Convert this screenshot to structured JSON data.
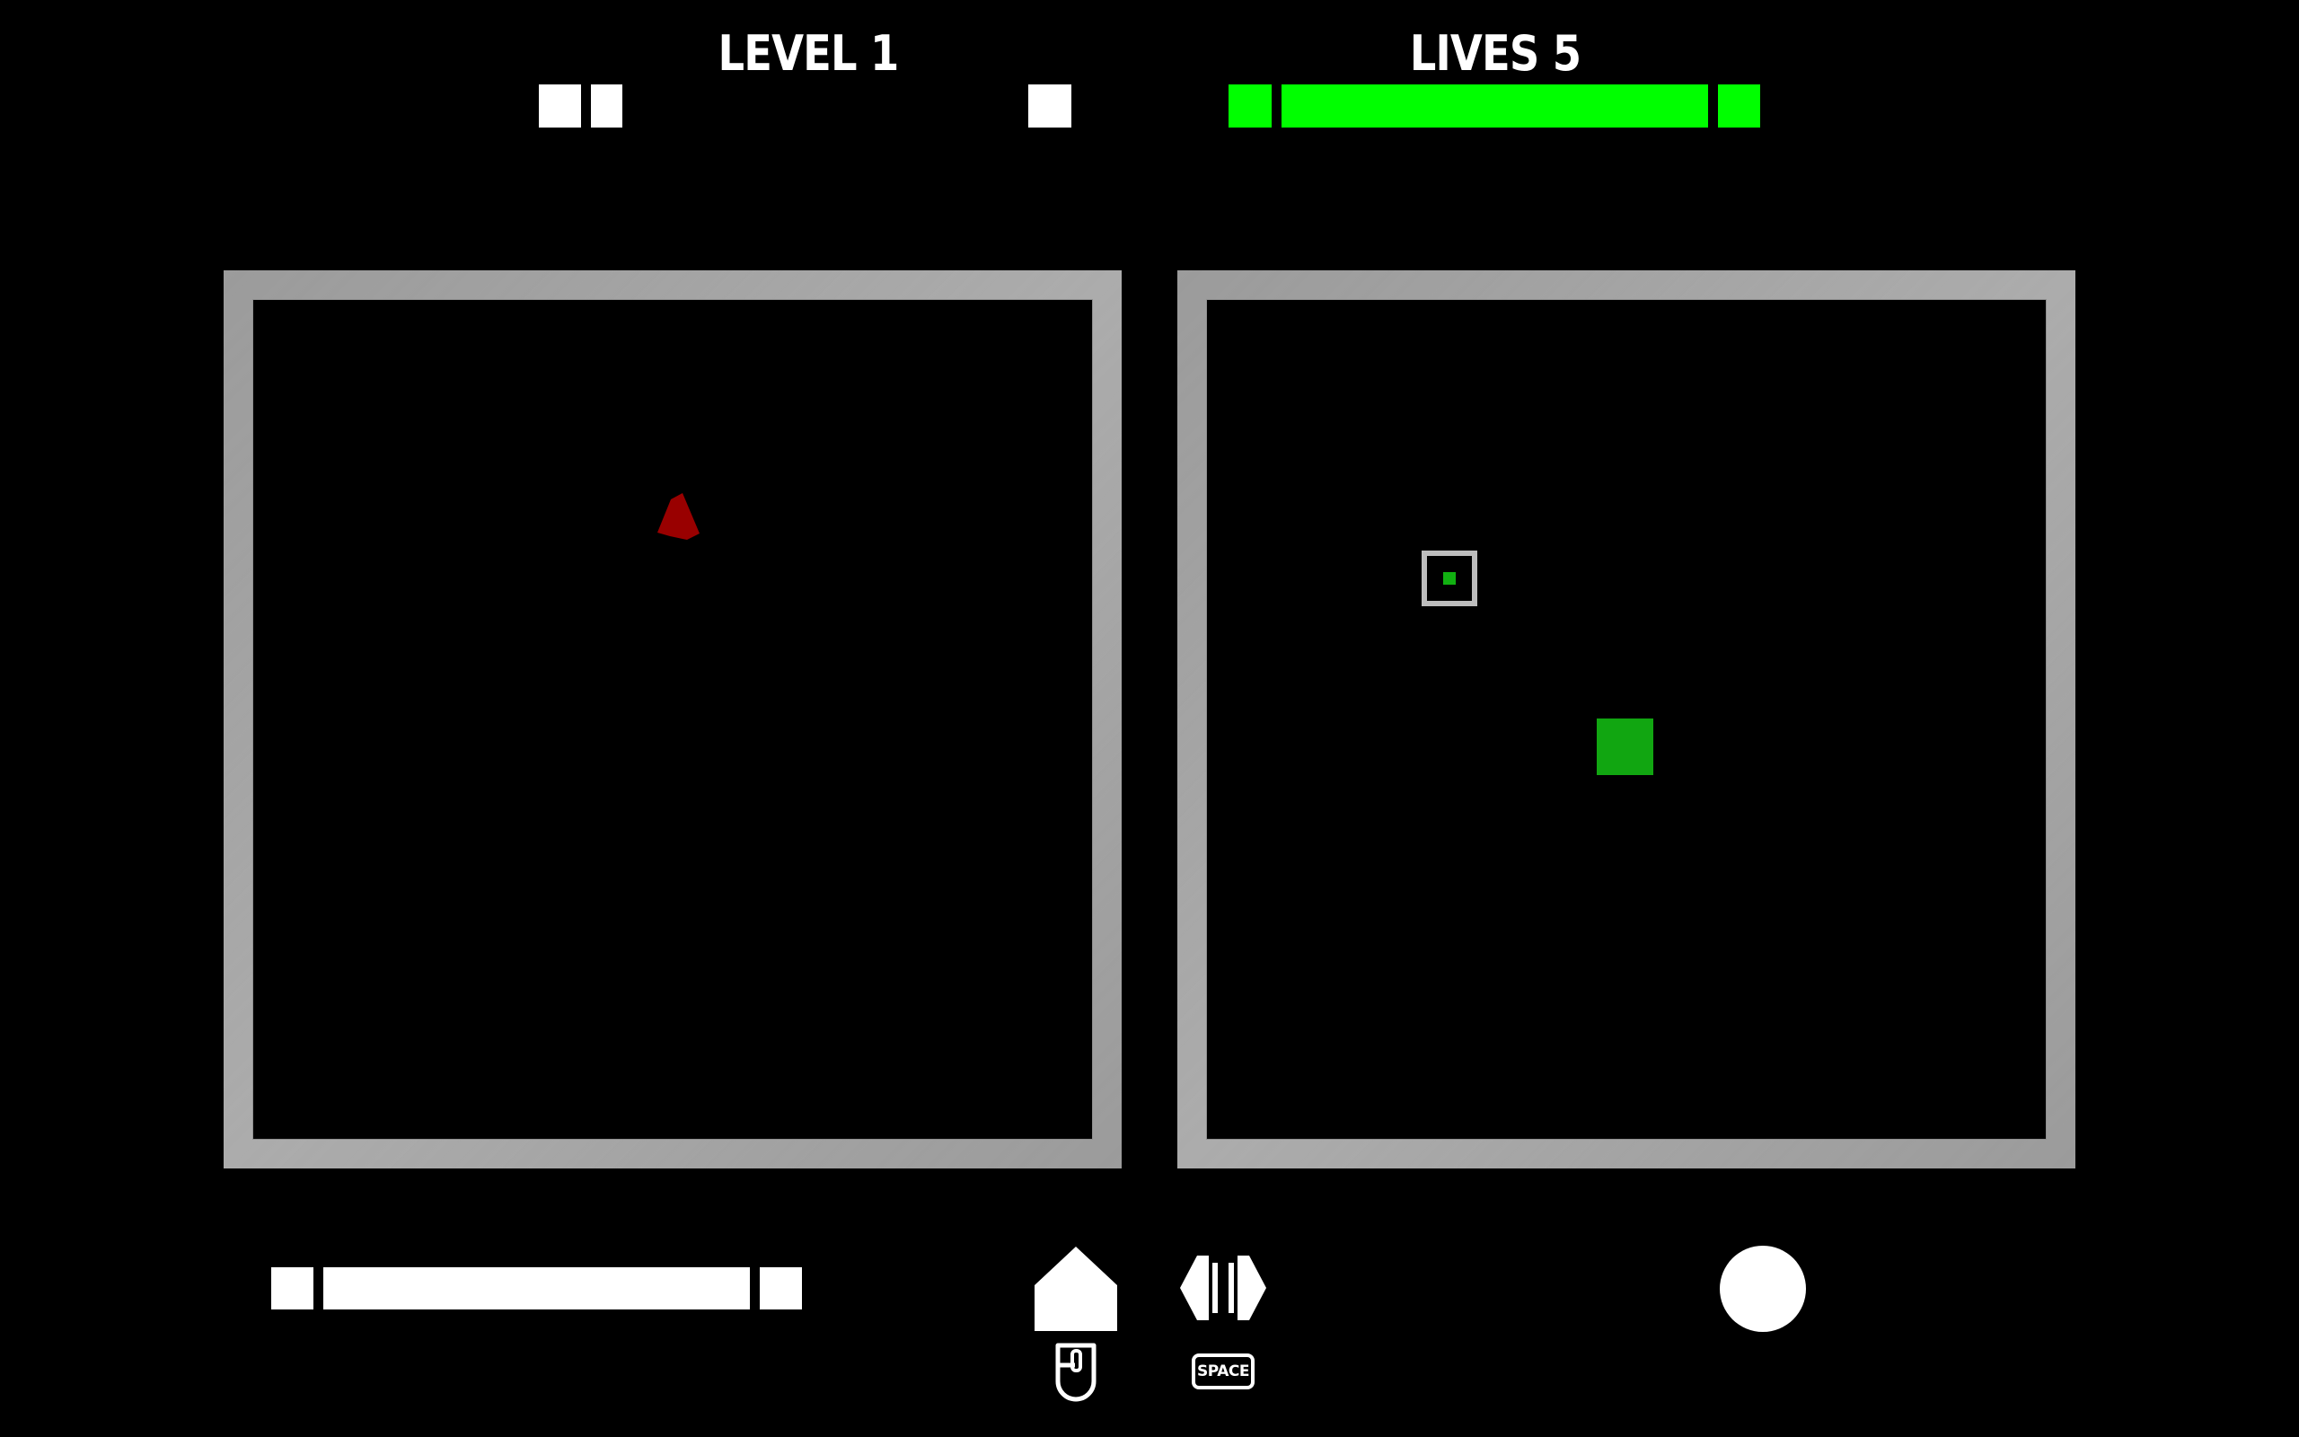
{
  "hud": {
    "level_label": "LEVEL 1",
    "lives_label": "LIVES 5",
    "lives_bar_color": "#00ff00",
    "power_bar_color": "#ffffff"
  },
  "panels": {
    "enemy_color": "#990000",
    "player_color": "#11a611",
    "target_color": "#11b011",
    "frame_color": "#a3a3a3"
  },
  "controls": {
    "jump_icon": "house-arrow-up-icon",
    "mouse_icon": "mouse-icon",
    "swap_icon": "left-right-arrows-icon",
    "space_key_label": "SPACE",
    "action_icon": "circle-icon"
  }
}
